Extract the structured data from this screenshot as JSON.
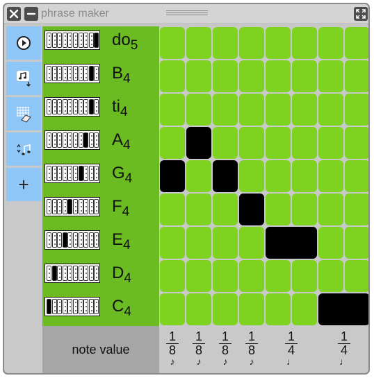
{
  "window": {
    "title": "phrase maker"
  },
  "toolbar": {
    "close_icon": "close-icon",
    "minimize_icon": "minimize-icon",
    "expand_icon": "expand-icon"
  },
  "sidebar": {
    "buttons": [
      {
        "name": "play-button",
        "icon": "play-icon"
      },
      {
        "name": "save-button",
        "icon": "music-save-icon"
      },
      {
        "name": "erase-button",
        "icon": "grid-eraser-icon"
      },
      {
        "name": "sort-button",
        "icon": "sort-notes-icon"
      },
      {
        "name": "add-button",
        "icon": "plus-icon",
        "label": "+"
      }
    ]
  },
  "rows": [
    {
      "name": "do",
      "octave": "5",
      "key_index": 9
    },
    {
      "name": "B",
      "octave": "4",
      "key_index": 8
    },
    {
      "name": "ti",
      "octave": "4",
      "key_index": 8
    },
    {
      "name": "A",
      "octave": "4",
      "key_index": 7
    },
    {
      "name": "G",
      "octave": "4",
      "key_index": 6
    },
    {
      "name": "F",
      "octave": "4",
      "key_index": 4
    },
    {
      "name": "E",
      "octave": "4",
      "key_index": 3
    },
    {
      "name": "D",
      "octave": "4",
      "key_index": 1
    },
    {
      "name": "C",
      "octave": "4",
      "key_index": 0
    }
  ],
  "note_value_label": "note value",
  "columns": [
    {
      "numerator": "1",
      "denominator": "8",
      "icon": "eighth-note-icon",
      "glyph": "♪"
    },
    {
      "numerator": "1",
      "denominator": "8",
      "icon": "eighth-note-icon",
      "glyph": "♪"
    },
    {
      "numerator": "1",
      "denominator": "8",
      "icon": "eighth-note-icon",
      "glyph": "♪"
    },
    {
      "numerator": "1",
      "denominator": "8",
      "icon": "eighth-note-icon",
      "glyph": "♪"
    },
    {
      "numerator": "1",
      "denominator": "4",
      "icon": "quarter-note-icon",
      "glyph": "♩"
    },
    {
      "numerator": "1",
      "denominator": "4",
      "icon": "quarter-note-icon",
      "glyph": "♩"
    }
  ],
  "selected_cells": [
    {
      "row": 4,
      "col": 0
    },
    {
      "row": 3,
      "col": 1
    },
    {
      "row": 4,
      "col": 2
    },
    {
      "row": 5,
      "col": 3
    },
    {
      "row": 6,
      "col": 4
    },
    {
      "row": 8,
      "col": 5
    }
  ],
  "colors": {
    "cell_empty": "#7ed321",
    "cell_selected": "#000000",
    "row_label_bg": "#6bbb23",
    "sidebar_button": "#8ec6f7",
    "note_value_bg": "#a6a6a6"
  }
}
